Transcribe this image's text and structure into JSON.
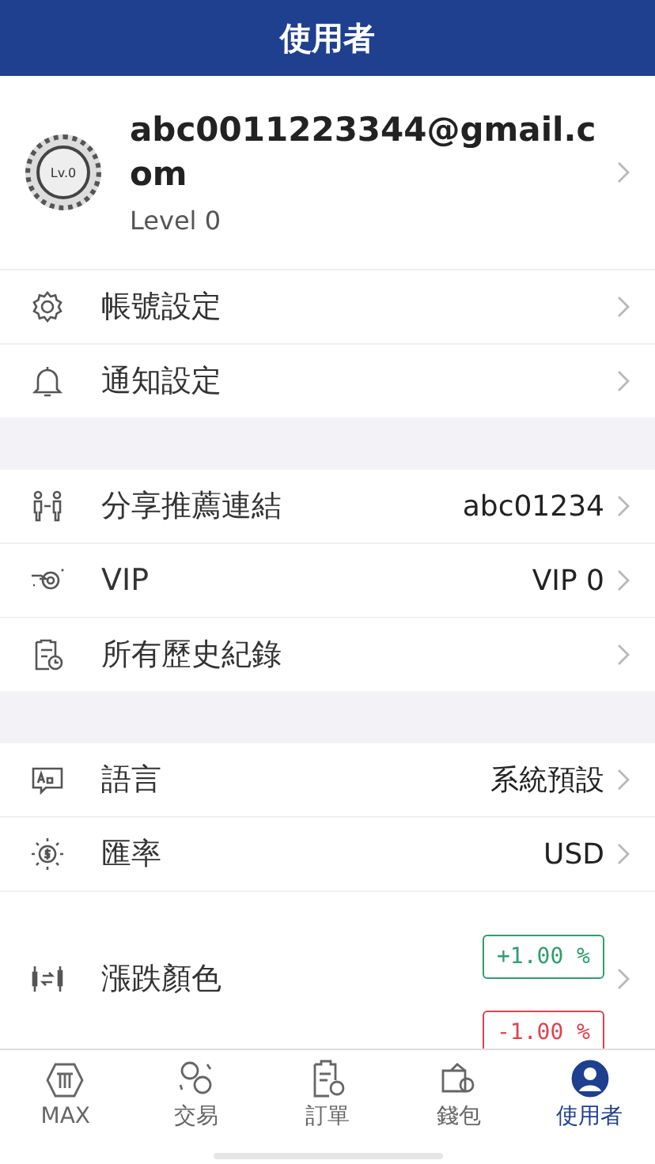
{
  "header": {
    "title": "使用者"
  },
  "profile": {
    "badge": "Lv.0",
    "email": "abc0011223344@gmail.com",
    "level": "Level 0"
  },
  "sections": [
    {
      "rows": [
        {
          "kind": "plain",
          "label": "帳號設定"
        },
        {
          "kind": "plain",
          "label": "通知設定"
        }
      ]
    },
    {
      "rows": [
        {
          "kind": "value",
          "label": "分享推薦連結",
          "value": "abc01234"
        },
        {
          "kind": "value",
          "label": "VIP",
          "value": "VIP 0"
        },
        {
          "kind": "plain",
          "label": "所有歷史紀錄"
        }
      ]
    },
    {
      "rows": [
        {
          "kind": "value",
          "label": "語言",
          "value": "系統預設"
        },
        {
          "kind": "value",
          "label": "匯率",
          "value": "USD"
        },
        {
          "kind": "colors",
          "label": "漲跌顏色",
          "badges": [
            {
              "text": "+1.00 %",
              "color": "#2e9e6b"
            },
            {
              "text": "-1.00 %",
              "color": "#e0414f"
            }
          ]
        }
      ]
    }
  ],
  "tabs": [
    {
      "label": "MAX",
      "selected": false
    },
    {
      "label": "交易",
      "selected": false
    },
    {
      "label": "訂單",
      "selected": false
    },
    {
      "label": "錢包",
      "selected": false
    },
    {
      "label": "使用者",
      "selected": true
    }
  ]
}
